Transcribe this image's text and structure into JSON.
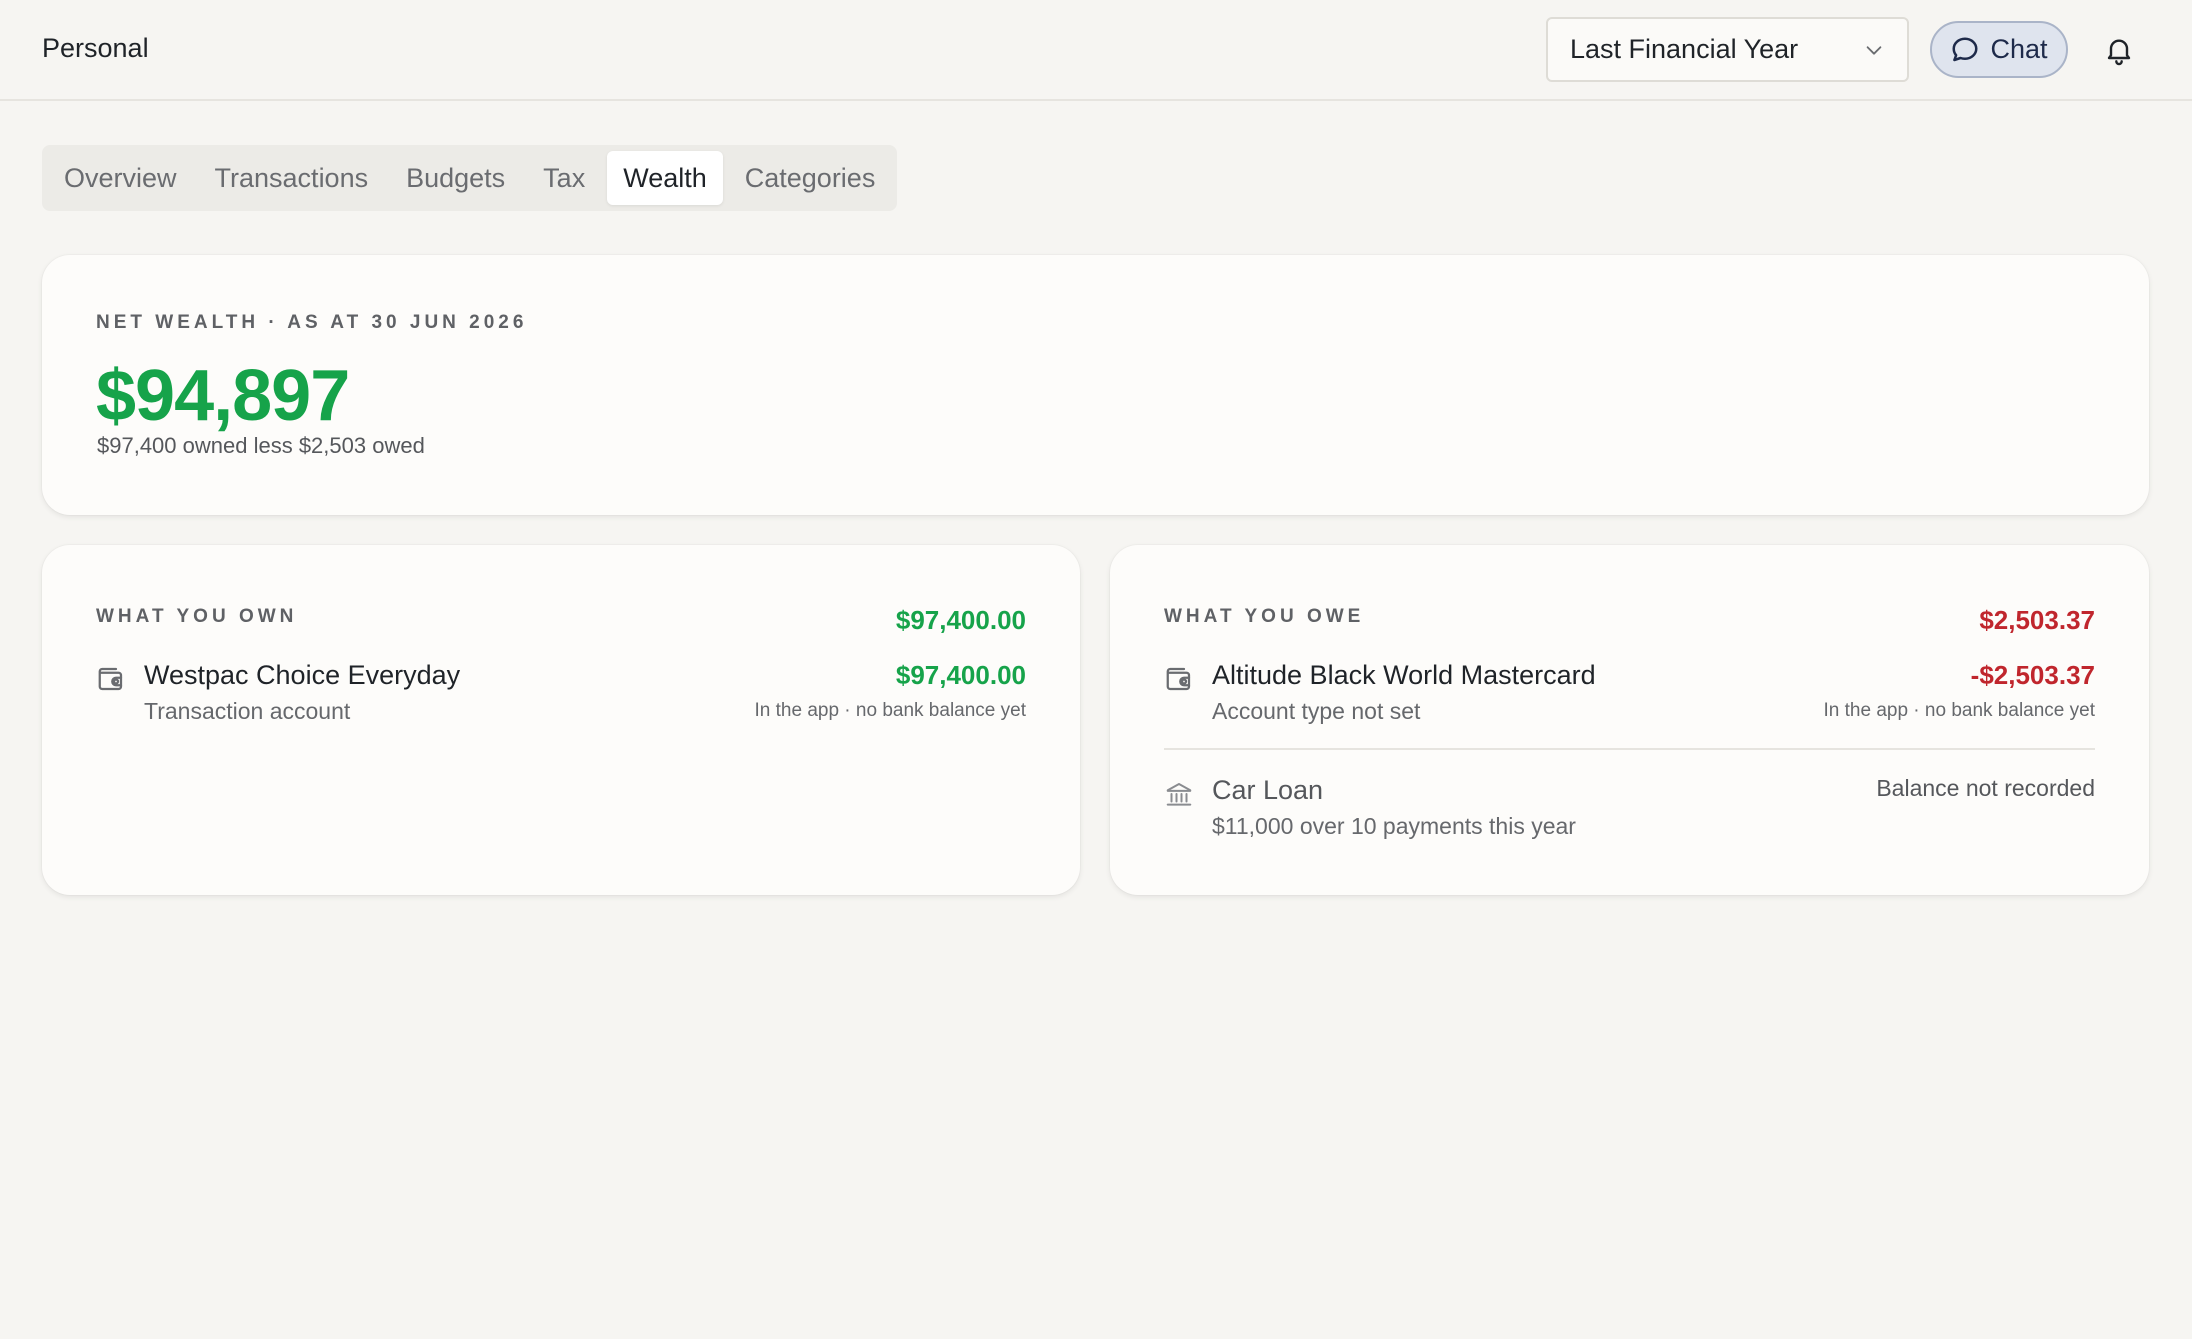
{
  "header": {
    "workspace": "Personal",
    "period_select": {
      "selected": "Last Financial Year"
    },
    "chat_label": "Chat"
  },
  "tabs": [
    {
      "label": "Overview",
      "active": false
    },
    {
      "label": "Transactions",
      "active": false
    },
    {
      "label": "Budgets",
      "active": false
    },
    {
      "label": "Tax",
      "active": false
    },
    {
      "label": "Wealth",
      "active": true
    },
    {
      "label": "Categories",
      "active": false
    }
  ],
  "net_wealth": {
    "heading": "NET WEALTH · AS AT 30 JUN 2026",
    "amount": "$94,897",
    "summary": "$97,400 owned less $2,503 owed"
  },
  "own": {
    "heading": "WHAT YOU OWN",
    "total": "$97,400.00",
    "accounts": [
      {
        "name": "Westpac Choice Everyday",
        "type": "Transaction account",
        "amount": "$97,400.00",
        "note": "In the app · no bank balance yet",
        "icon": "wallet-icon"
      }
    ]
  },
  "owe": {
    "heading": "WHAT YOU OWE",
    "total": "$2,503.37",
    "accounts": [
      {
        "name": "Altitude Black World Mastercard",
        "type": "Account type not set",
        "amount": "-$2,503.37",
        "note": "In the app · no bank balance yet",
        "icon": "wallet-icon"
      },
      {
        "name": "Car Loan",
        "type": "$11,000 over 10 payments this year",
        "status": "Balance not recorded",
        "icon": "bank-icon"
      }
    ]
  },
  "colors": {
    "positive": "#16a34a",
    "negative": "#c0262d",
    "background": "#f6f5f2",
    "card": "#fdfcfa"
  }
}
